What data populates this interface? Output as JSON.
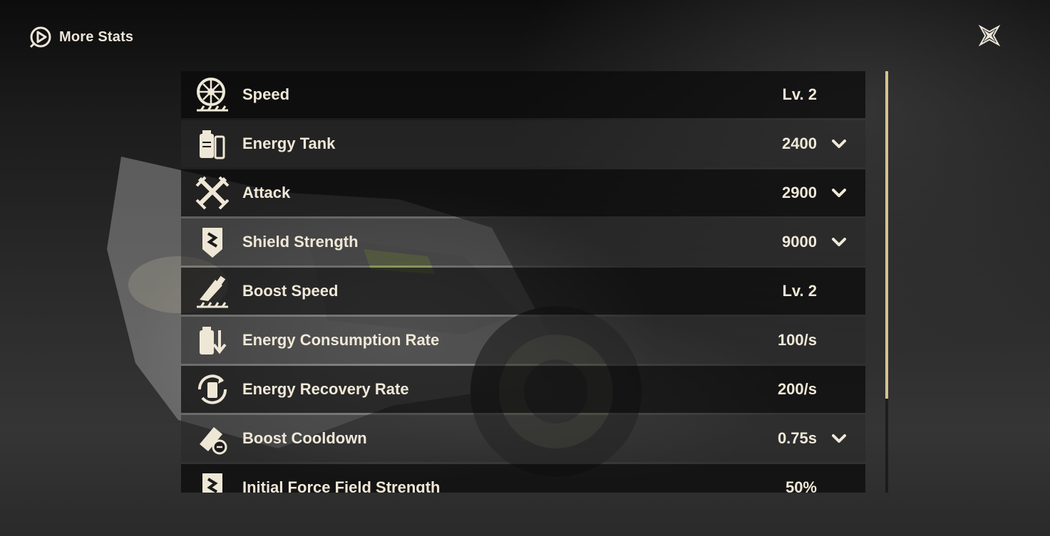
{
  "header": {
    "title": "More Stats",
    "icon": "stats-icon"
  },
  "close": {
    "icon": "close-icon"
  },
  "stats": [
    {
      "icon": "speed-wheel-icon",
      "label": "Speed",
      "value": "Lv. 2",
      "expandable": false
    },
    {
      "icon": "energy-tank-icon",
      "label": "Energy Tank",
      "value": "2400",
      "expandable": true
    },
    {
      "icon": "attack-swords-icon",
      "label": "Attack",
      "value": "2900",
      "expandable": true
    },
    {
      "icon": "shield-icon",
      "label": "Shield Strength",
      "value": "9000",
      "expandable": true
    },
    {
      "icon": "boost-speed-icon",
      "label": "Boost Speed",
      "value": "Lv. 2",
      "expandable": false
    },
    {
      "icon": "energy-consumption-icon",
      "label": "Energy Consumption Rate",
      "value": "100/s",
      "expandable": false
    },
    {
      "icon": "energy-recovery-icon",
      "label": "Energy Recovery Rate",
      "value": "200/s",
      "expandable": false
    },
    {
      "icon": "boost-cooldown-icon",
      "label": "Boost Cooldown",
      "value": "0.75s",
      "expandable": true
    },
    {
      "icon": "force-field-icon",
      "label": "Initial Force Field Strength",
      "value": "50%",
      "expandable": false
    }
  ],
  "scroll": {
    "fraction_visible": 0.78,
    "position": 0
  },
  "colors": {
    "accent": "#d7c48e",
    "text": "#f0e8d8"
  }
}
